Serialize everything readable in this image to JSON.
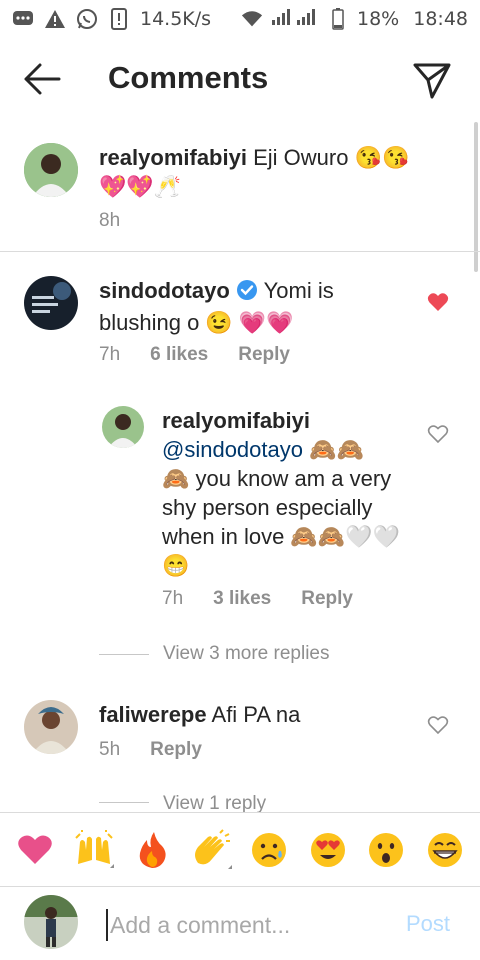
{
  "status_bar": {
    "network_speed": "14.5K/s",
    "battery": "18%",
    "time": "18:48"
  },
  "header": {
    "title": "Comments"
  },
  "caption": {
    "username": "realyomifabiyi",
    "text_line1": "Eji Owuro 😘😘",
    "text_line2": "💖💖🥂",
    "time": "8h"
  },
  "comments": [
    {
      "username": "sindodotayo",
      "verified": true,
      "text_line1": "Yomi is",
      "text_line2": "blushing o 😉 💗💗",
      "time": "7h",
      "likes": "6 likes",
      "reply": "Reply",
      "liked": true
    },
    {
      "username": "realyomifabiyi",
      "mention": "@sindodotayo",
      "mention_suffix": " 🙈🙈",
      "text_line2": "🙈 you know am a very",
      "text_line3": "shy person especially",
      "text_line4": "when in love 🙈🙈🤍🤍",
      "text_line5": "😁",
      "time": "7h",
      "likes": "3 likes",
      "reply": "Reply",
      "liked": false
    },
    {
      "username": "faliwerepe",
      "text": "Afi PA na",
      "time": "5h",
      "reply": "Reply",
      "liked": false
    }
  ],
  "view_more_replies": "View 3 more replies",
  "view_reply": "View 1 reply",
  "emoji_bar": [
    "❤️",
    "🙌",
    "🔥",
    "👏",
    "😢",
    "😍",
    "😮",
    "😂"
  ],
  "input": {
    "placeholder": "Add a comment...",
    "post_label": "Post"
  }
}
